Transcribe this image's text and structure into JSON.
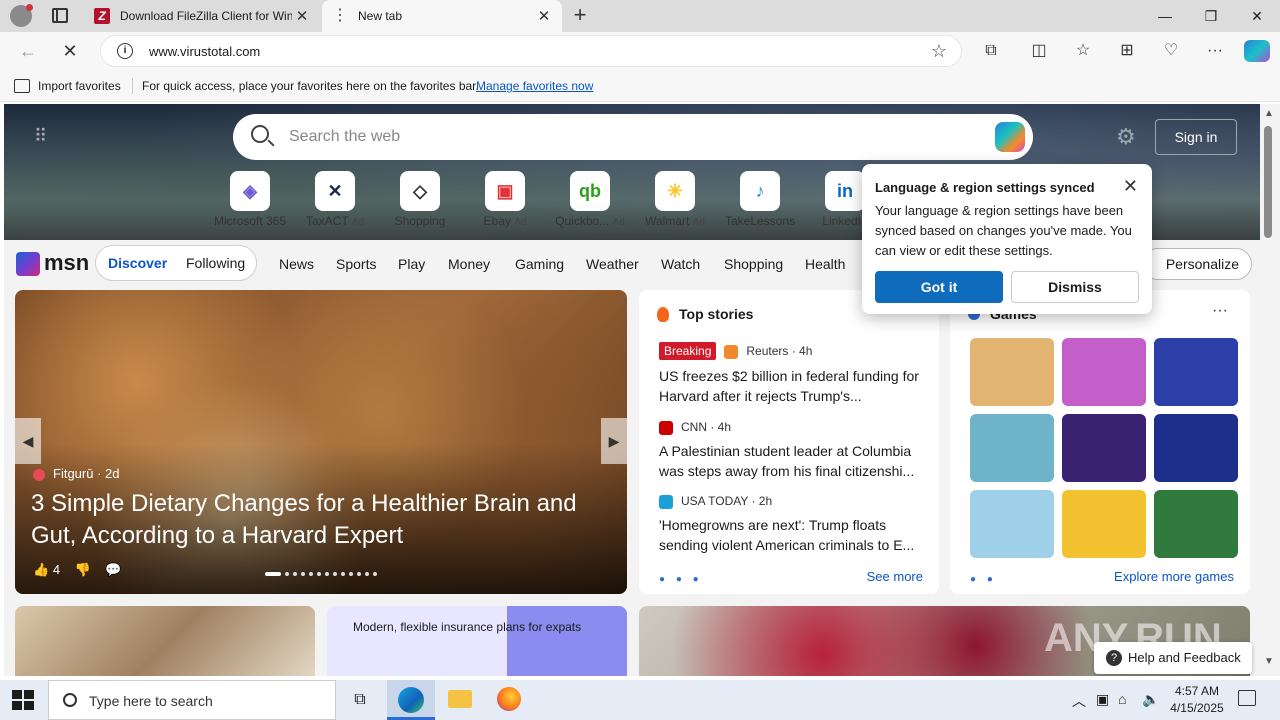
{
  "browser": {
    "tabs": [
      {
        "title": "Download FileZilla Client for Win",
        "favicon": "filezilla-icon",
        "close": "✕"
      },
      {
        "title": "New tab",
        "favicon": "loading-icon",
        "close": "✕"
      }
    ],
    "new_tab": "+",
    "window_controls": {
      "minimize": "—",
      "restore": "❐",
      "close": "✕"
    },
    "url": "www.virustotal.com"
  },
  "favorites_bar": {
    "import_label": "Import favorites",
    "message": "For quick access, place your favorites here on the favorites bar.",
    "manage_link": "Manage favorites now"
  },
  "msn": {
    "search_placeholder": "Search the web",
    "sign_in": "Sign in",
    "quick_links": [
      {
        "label": "Microsoft 365",
        "ad": "",
        "icon": "microsoft365-icon",
        "glyph": "◈",
        "color": "#6b5bd6"
      },
      {
        "label": "TaxACT",
        "ad": "Ad",
        "icon": "taxact-icon",
        "glyph": "✕",
        "color": "#1b2b4a"
      },
      {
        "label": "Shopping",
        "ad": "",
        "icon": "shopping-tag-icon",
        "glyph": "◇",
        "color": "#333333"
      },
      {
        "label": "Ebay",
        "ad": "Ad",
        "icon": "ebay-icon",
        "glyph": "▣",
        "color": "#e53238"
      },
      {
        "label": "Quickbo...",
        "ad": "Ad",
        "icon": "quickbooks-icon",
        "glyph": "qb",
        "color": "#2ca01c"
      },
      {
        "label": "Walmart",
        "ad": "Ad",
        "icon": "walmart-icon",
        "glyph": "✳",
        "color": "#ffc220"
      },
      {
        "label": "TakeLessons",
        "ad": "",
        "icon": "takelessons-icon",
        "glyph": "♪",
        "color": "#1f8ec9"
      },
      {
        "label": "LinkedIn",
        "ad": "",
        "icon": "linkedin-icon",
        "glyph": "in",
        "color": "#0a66c2"
      }
    ],
    "logo_text": "msn",
    "discover": "Discover",
    "following": "Following",
    "nav": [
      "News",
      "Sports",
      "Play",
      "Money",
      "Gaming",
      "Weather",
      "Watch",
      "Shopping",
      "Health"
    ],
    "personalize": "Personalize",
    "feature": {
      "source": "Fitgurū",
      "age": "2d",
      "headline": "3 Simple Dietary Changes for a Healthier Brain and Gut, According to a Harvard Expert",
      "likes": "4"
    },
    "top_stories": {
      "title": "Top stories",
      "items": [
        {
          "badge": "Breaking",
          "source": "Reuters · 4h",
          "icon_color": "#f08a2a",
          "headline": "US freezes $2 billion in federal funding for Harvard after it rejects Trump's..."
        },
        {
          "badge": "",
          "source": "CNN · 4h",
          "icon_color": "#cc0000",
          "headline": "A Palestinian student leader at Columbia was steps away from his final citizenshi..."
        },
        {
          "badge": "",
          "source": "USA TODAY · 2h",
          "icon_color": "#1a9fd6",
          "headline": "'Homegrowns are next': Trump floats sending violent American criminals to E..."
        }
      ],
      "see_more": "See more"
    },
    "games": {
      "title": "Games",
      "menu": "···",
      "explore": "Explore more games",
      "tiles": [
        {
          "name": "game-tile-wood-puzzle",
          "color": "#e2b472"
        },
        {
          "name": "game-tile-makeup",
          "color": "#c45ec9"
        },
        {
          "name": "game-tile-jewels",
          "color": "#2c3fa8"
        },
        {
          "name": "game-tile-story",
          "color": "#6fb3c9"
        },
        {
          "name": "game-tile-bubble-shooter",
          "color": "#3b2270"
        },
        {
          "name": "game-tile-blocks",
          "color": "#1d2f8a"
        },
        {
          "name": "game-tile-thief",
          "color": "#9ed0ea"
        },
        {
          "name": "game-tile-crazy-cube",
          "color": "#f2c230"
        },
        {
          "name": "game-tile-mahjong",
          "color": "#2f7a3c"
        }
      ]
    },
    "promo": {
      "text": "Modern, flexible insurance plans for expats"
    },
    "help": "Help and Feedback",
    "watermark": "ANY.RUN"
  },
  "popup": {
    "title": "Language & region settings synced",
    "body": "Your language & region settings have been synced based on changes you've made. You can view or edit these settings.",
    "got_it": "Got it",
    "dismiss": "Dismiss"
  },
  "taskbar": {
    "search_placeholder": "Type here to search",
    "time": "4:57 AM",
    "date": "4/15/2025"
  }
}
